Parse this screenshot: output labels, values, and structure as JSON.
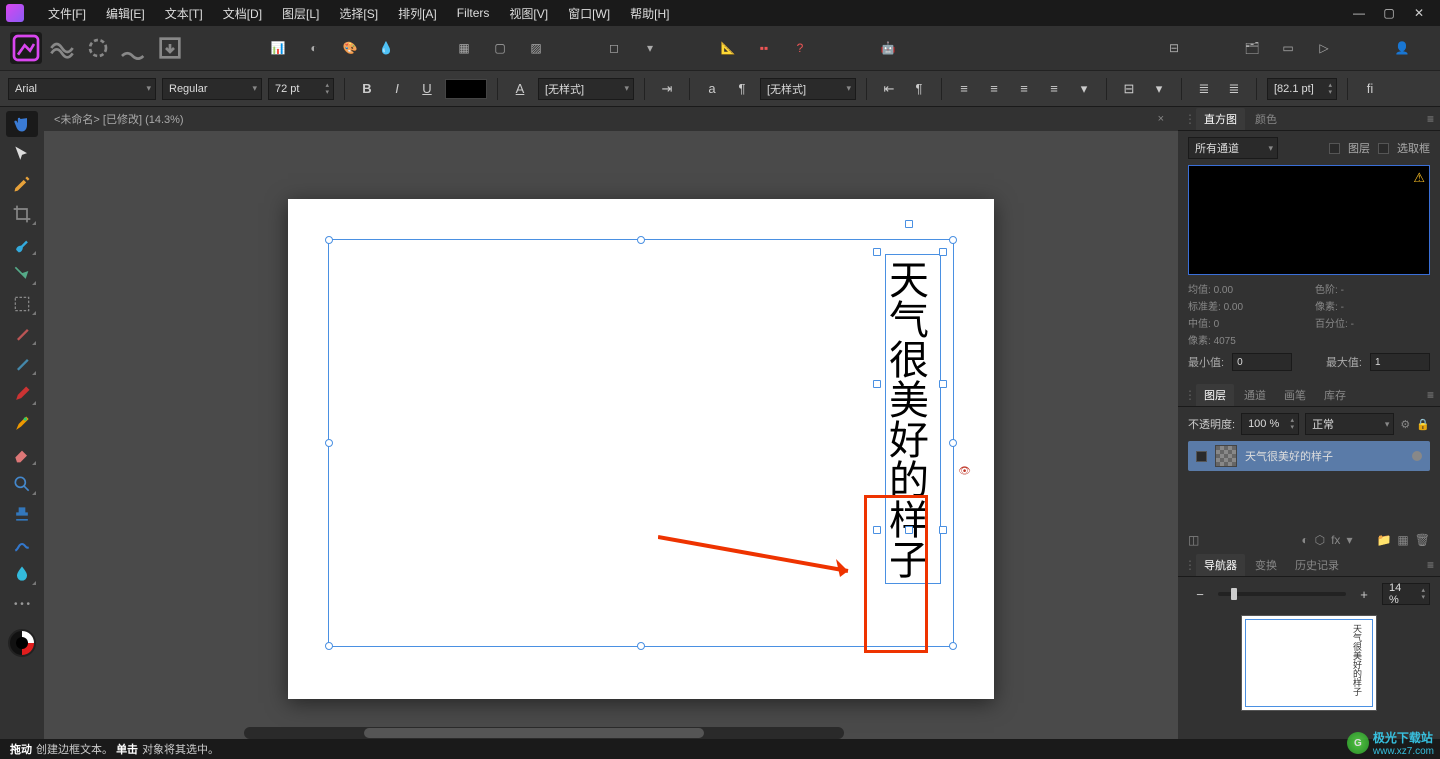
{
  "menubar": {
    "items": [
      "文件[F]",
      "编辑[E]",
      "文本[T]",
      "文档[D]",
      "图层[L]",
      "选择[S]",
      "排列[A]",
      "Filters",
      "视图[V]",
      "窗口[W]",
      "帮助[H]"
    ]
  },
  "window_controls": {
    "min": "—",
    "max": "▢",
    "close": "✕"
  },
  "text_options": {
    "font": "Arial",
    "weight": "Regular",
    "size": "72 pt",
    "bold": "B",
    "italic": "I",
    "underline": "U",
    "char_style_a": "A",
    "char_style_dd": "[无样式]",
    "para_a": "a",
    "para_pilcrow": "¶",
    "para_style_dd": "[无样式]",
    "outdent": "⇤",
    "pilcrow2": "¶",
    "leading": "[82.1 pt]",
    "ligature": "fi"
  },
  "doc_tab": {
    "title": "<未命名> [已修改] (14.3%)",
    "close": "×"
  },
  "canvas_text": "天气很美好的样子",
  "panels": {
    "histogram": {
      "tabs": [
        "直方图",
        "颜色"
      ],
      "channel": "所有通道",
      "layer_chk": "图层",
      "marquee_chk": "选取框",
      "stats": {
        "mean_l": "均值:",
        "mean_v": "0.00",
        "std_l": "标准差:",
        "std_v": "0.00",
        "median_l": "中值:",
        "median_v": "0",
        "pixels_l": "像素:",
        "pixels_v": "4075",
        "grad_l": "色阶:",
        "grad_v": "-",
        "px_l": "像素:",
        "px_v": "-",
        "pct_l": "百分位:",
        "pct_v": "-"
      },
      "min_l": "最小值:",
      "min_v": "0",
      "max_l": "最大值:",
      "max_v": "1"
    },
    "layers": {
      "tabs": [
        "图层",
        "通道",
        "画笔",
        "库存"
      ],
      "opacity_l": "不透明度:",
      "opacity_v": "100 %",
      "blend": "正常",
      "layer_name": "天气很美好的样子"
    },
    "navigator": {
      "tabs": [
        "导航器",
        "变换",
        "历史记录"
      ],
      "zoom": "14 %",
      "minus": "−",
      "plus": "+",
      "thumb_text": "天气很美好的样子"
    }
  },
  "status": {
    "drag": "拖动",
    "drag_t": "创建边框文本。",
    "click": "单击",
    "click_t": "对象将其选中。"
  },
  "watermark": {
    "name": "极光下载站",
    "url": "www.xz7.com"
  },
  "colors": {
    "accent": "#4a90e2",
    "red": "#e30"
  }
}
